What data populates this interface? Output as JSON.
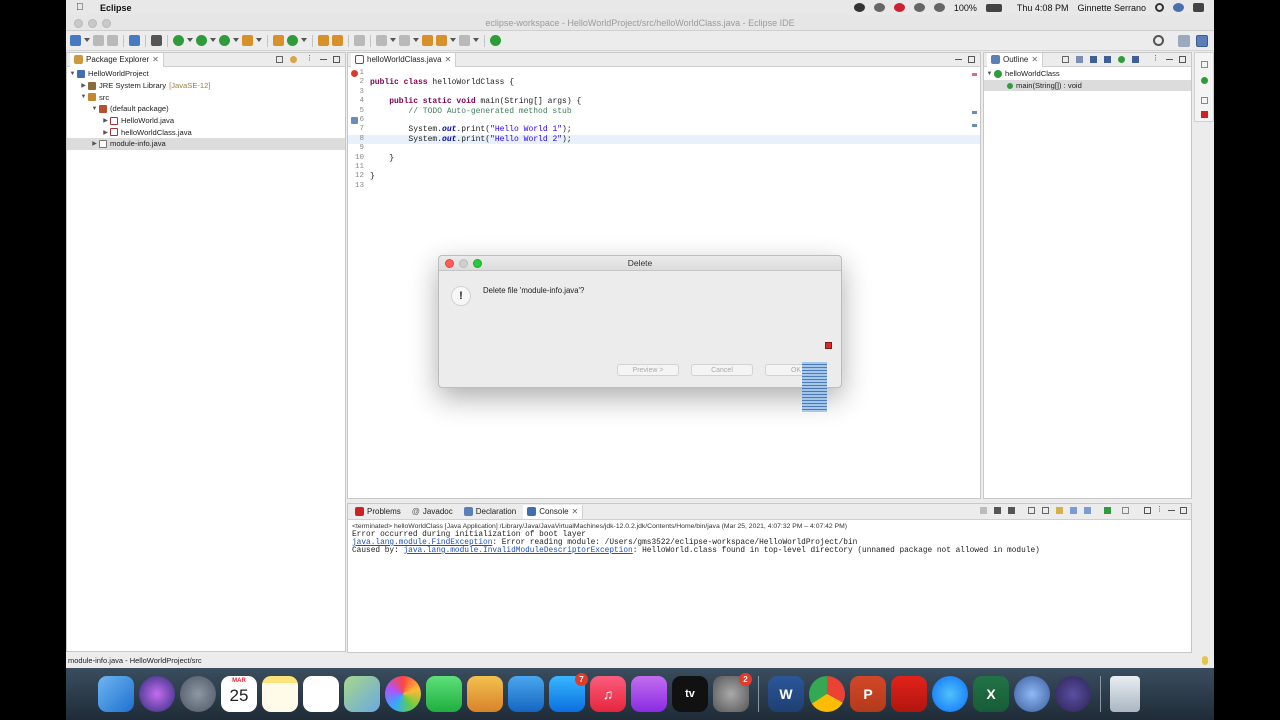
{
  "menubar": {
    "app_name": "Eclipse",
    "battery": "100%",
    "clock": "Thu 4:08 PM",
    "user": "Ginnette Serrano"
  },
  "window": {
    "title": "eclipse-workspace - HelloWorldProject/src/helloWorldClass.java - Eclipse IDE"
  },
  "package_explorer": {
    "tab_label": "Package Explorer",
    "items": [
      {
        "label": "HelloWorldProject",
        "extra": ""
      },
      {
        "label": "JRE System Library",
        "extra": "[JavaSE-12]"
      },
      {
        "label": "src",
        "extra": ""
      },
      {
        "label": "(default package)",
        "extra": ""
      },
      {
        "label": "HelloWorld.java",
        "extra": ""
      },
      {
        "label": "helloWorldClass.java",
        "extra": ""
      },
      {
        "label": "module-info.java",
        "extra": ""
      }
    ]
  },
  "editor": {
    "tab_label": "helloWorldClass.java",
    "line_numbers": [
      "1",
      "2",
      "3",
      "4",
      "5",
      "6",
      "7",
      "8",
      "9",
      "10",
      "11",
      "12",
      "13"
    ],
    "code": {
      "l2_kw": "public class",
      "l2_rest": " helloWorldClass {",
      "l4_kw": "public static void",
      "l4_rest": " main(String[] args) {",
      "l5_comment": "// TODO Auto-generated method stub",
      "l7_pre": "System.",
      "l7_field": "out",
      "l7_mid": ".print(",
      "l7_str": "\"Hello World 1\"",
      "l7_end": ");",
      "l8_pre": "System.",
      "l8_field": "out",
      "l8_mid": ".print(",
      "l8_str": "\"Hello World 2\"",
      "l8_end": ");",
      "l10": "}",
      "l12": "}"
    }
  },
  "outline": {
    "tab_label": "Outline",
    "items": [
      {
        "label": "helloWorldClass"
      },
      {
        "label": "main(String[]) : void"
      }
    ]
  },
  "console": {
    "tabs": [
      "Problems",
      "Javadoc",
      "Declaration",
      "Console"
    ],
    "at_symbol": "@",
    "terminated": "<terminated> helloWorldClass [Java Application] /Library/Java/JavaVirtualMachines/jdk-12.0.2.jdk/Contents/Home/bin/java  (Mar 25, 2021, 4:07:32 PM – 4:07:42 PM)",
    "line1": "Error occurred during initialization of boot layer",
    "line2_link": "java.lang.module.FindException",
    "line2_rest": ": Error reading module: /Users/gms3522/eclipse-workspace/HelloWorldProject/bin",
    "line3_pre": "Caused by: ",
    "line3_link": "java.lang.module.InvalidModuleDescriptorException",
    "line3_rest": ": HelloWorld.class found in top-level directory (unnamed package not allowed in module)"
  },
  "status_bar": {
    "text": "module-info.java - HelloWorldProject/src"
  },
  "dialog": {
    "title": "Delete",
    "message": "Delete file 'module-info.java'?",
    "preview_label": "Preview >",
    "cancel_label": "Cancel",
    "ok_label": "OK"
  },
  "dock": {
    "calendar_month": "MAR",
    "calendar_day": "25",
    "app_store_badge": "7",
    "prefs_badge": "2",
    "tv_label": "tv"
  },
  "colors": {
    "keyword": "#7f0055",
    "string": "#2a00ff",
    "comment": "#3f7f5f",
    "link": "#1d4fb8",
    "error": "#d83b2a"
  }
}
